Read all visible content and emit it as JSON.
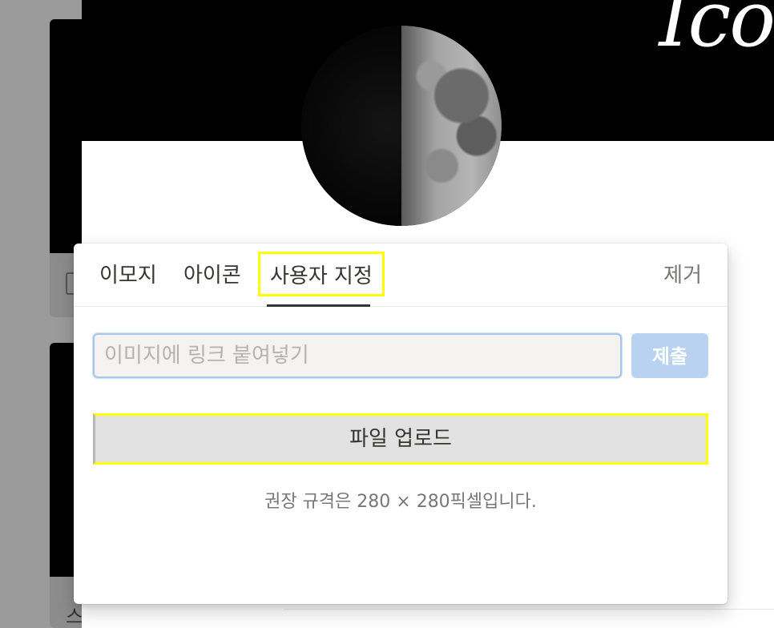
{
  "cover": {
    "title": "Ico"
  },
  "tabs": {
    "emoji": "이모지",
    "icon": "아이콘",
    "custom": "사용자 지정",
    "remove": "제거"
  },
  "link": {
    "placeholder": "이미지에 링크 붙여넣기",
    "submit": "제출"
  },
  "upload": {
    "label": "파일 업로드"
  },
  "hint": "권장 규격은 280 × 280픽셀입니다.",
  "background": {
    "card2_glyph": "스"
  },
  "colors": {
    "highlight": "#ffff00",
    "submit_bg": "#b9d2f1",
    "input_border": "#a8c6ee",
    "text": "#37352f",
    "muted": "#787774"
  }
}
